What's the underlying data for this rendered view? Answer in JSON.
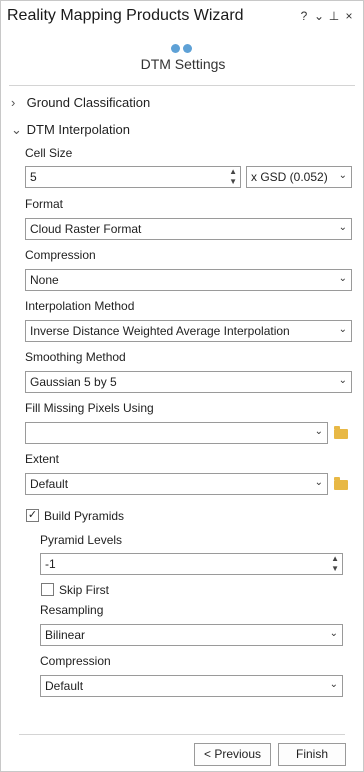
{
  "window": {
    "title": "Reality Mapping Products Wizard",
    "icons": {
      "help": "?",
      "menu": "⌄",
      "pin": "⊥",
      "close": "×"
    }
  },
  "header": {
    "step_title": "DTM Settings"
  },
  "sections": {
    "ground_classification": "Ground Classification",
    "dtm_interpolation": "DTM Interpolation"
  },
  "fields": {
    "cell_size_label": "Cell Size",
    "cell_size_value": "5",
    "cell_size_unit": "x GSD (0.052)",
    "format_label": "Format",
    "format_value": "Cloud Raster Format",
    "compression_label": "Compression",
    "compression_value": "None",
    "interp_label": "Interpolation Method",
    "interp_value": "Inverse Distance Weighted Average Interpolation",
    "smoothing_label": "Smoothing Method",
    "smoothing_value": "Gaussian 5 by 5",
    "fill_label": "Fill Missing Pixels Using",
    "fill_value": "",
    "extent_label": "Extent",
    "extent_value": "Default",
    "build_pyramids_label": "Build Pyramids",
    "build_pyramids_checked": true,
    "pyramid_levels_label": "Pyramid Levels",
    "pyramid_levels_value": "-1",
    "skip_first_label": "Skip First",
    "skip_first_checked": false,
    "resampling_label": "Resampling",
    "resampling_value": "Bilinear",
    "pyr_compression_label": "Compression",
    "pyr_compression_value": "Default"
  },
  "buttons": {
    "previous": "< Previous",
    "finish": "Finish"
  },
  "colors": {
    "accent": "#5ea1d6",
    "folder": "#e8b845"
  }
}
